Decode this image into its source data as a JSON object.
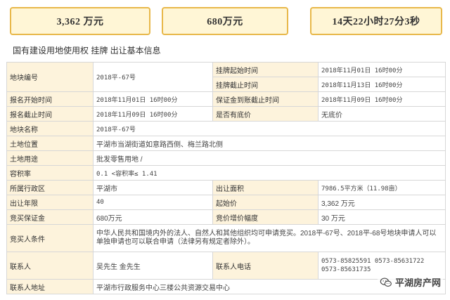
{
  "summary": {
    "floor_price_big": "3,362 万元",
    "deposit_big": "680万元",
    "countdown": "14天22小时27分3秒"
  },
  "section_title": "国有建设用地使用权 挂牌 出让基本信息",
  "rows": {
    "parcel_no_label": "地块编号",
    "parcel_no_value": "2018平-67号",
    "listing_start_label": "挂牌起始时间",
    "listing_start_value": "2018年11月01日 16时00分",
    "listing_end_label": "挂牌截止时间",
    "listing_end_value": "2018年11月13日 16时00分",
    "apply_start_label": "报名开始时间",
    "apply_start_value": "2018年11月01日 16时00分",
    "deposit_deadline_label": "保证金到账截止时间",
    "deposit_deadline_value": "2018年11月09日 16时00分",
    "apply_end_label": "报名截止时间",
    "apply_end_value": "2018年11月09日 16时00分",
    "reserve_label": "是否有底价",
    "reserve_value": "无底价",
    "parcel_name_label": "地块名称",
    "parcel_name_value": "2018平-67号",
    "location_label": "土地位置",
    "location_value": "平湖市当湖街道如意路西侧、梅兰路北侧",
    "usage_label": "土地用途",
    "usage_value": "批发零售用地 /",
    "far_label": "容积率",
    "far_value": "0.1 <容积率≤ 1.41",
    "district_label": "所属行政区",
    "district_value": "平湖市",
    "area_label": "出让面积",
    "area_value": "7986.5平方米（11.98亩）",
    "term_label": "出让年限",
    "term_value": "40",
    "start_price_label": "起始价",
    "start_price_value": "3,362 万元",
    "deposit_label": "竞买保证金",
    "deposit_value": "680万元",
    "increment_label": "竞价增价幅度",
    "increment_value": "30 万元",
    "bidder_label": "竞买人条件",
    "bidder_value": "中华人民共和国境内外的法人、自然人和其他组织均可申请竞买。2018平-67号、2018平-68号地块申请人可以单独申请也可以联合申请（法律另有规定者除外）。",
    "contact_label": "联系人",
    "contact_value": "吴先生 金先生",
    "phone_label": "联系人电话",
    "phone_value": "0573-85825591 0573-85631722 0573-85631735",
    "address_label": "联系人地址",
    "address_value": "平湖市行政服务中心三楼公共资源交易中心"
  },
  "watermark": {
    "text": "平湖房产网",
    "icon": "wechat-icon"
  }
}
